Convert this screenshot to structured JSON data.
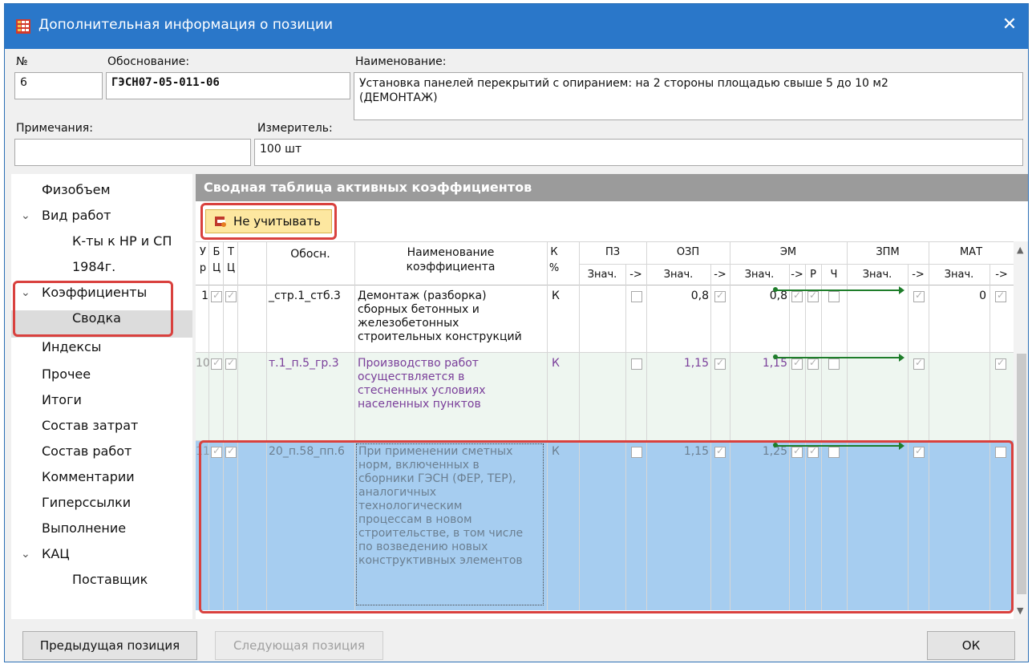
{
  "window": {
    "title": "Дополнительная информация о позиции",
    "close_icon": "close-icon"
  },
  "fields": {
    "num_label": "№",
    "num_value": "6",
    "basis_label": "Обоснование:",
    "basis_value": "ГЭСН07-05-011-06",
    "name_label": "Наименование:",
    "name_value_line1": "Установка панелей перекрытий с опиранием: на 2 стороны площадью свыше 5 до 10 м2",
    "name_value_line2": "(ДЕМОНТАЖ)",
    "notes_label": "Примечания:",
    "notes_value": "",
    "unit_label": "Измеритель:",
    "unit_value": "100 шт"
  },
  "nav": {
    "items": [
      {
        "label": "Физобъем"
      },
      {
        "label": "Вид работ",
        "expandable": true
      },
      {
        "label": "К-ты к НР и СП"
      },
      {
        "label": "1984г."
      },
      {
        "label": "Коэффициенты",
        "expandable": true
      },
      {
        "label": "Сводка",
        "selected": true
      },
      {
        "label": "Индексы"
      },
      {
        "label": "Прочее"
      },
      {
        "label": "Итоги"
      },
      {
        "label": "Состав затрат"
      },
      {
        "label": "Состав работ"
      },
      {
        "label": "Комментарии"
      },
      {
        "label": "Гиперссылки"
      },
      {
        "label": "Выполнение"
      },
      {
        "label": "КАЦ",
        "expandable": true
      },
      {
        "label": "Поставщик"
      }
    ]
  },
  "panel": {
    "header": "Сводная таблица активных коэффициентов",
    "ignore_button": "Не учитывать",
    "columns": {
      "ur1": "У",
      "ur2": "р",
      "bc1": "Б",
      "bc2": "Ц",
      "tc1": "Т",
      "tc2": "Ц",
      "basis": "Обосн.",
      "name1": "Наименование",
      "name2": "коэффициента",
      "kp1": "К",
      "kp2": "%",
      "pz": "ПЗ",
      "ozp": "ОЗП",
      "em": "ЭМ",
      "zpm": "ЗПМ",
      "mat": "МАТ",
      "val": "Знач.",
      "arrow": "->",
      "r": "Р",
      "ch": "Ч"
    },
    "rows": [
      {
        "level": "1",
        "basis": "_стр.1_стб.3",
        "name_lines": [
          "Демонтаж (разборка)",
          "сборных бетонных и",
          "железобетонных",
          "строительных конструкций"
        ],
        "k": "К",
        "ozp": "0,8",
        "em": "0,8",
        "mat": "0"
      },
      {
        "level": "10",
        "basis": "т.1_п.5_гр.3",
        "name_lines": [
          "Производство работ",
          "осуществляется в",
          "стесненных условиях",
          "населенных пунктов"
        ],
        "k": "К",
        "ozp": "1,15",
        "em": "1,15",
        "mat": ""
      },
      {
        "level": "11",
        "basis": "20_п.58_пп.6",
        "name_lines": [
          "При применении сметных",
          "норм, включенных в",
          "сборники ГЭСН (ФЕР, ТЕР),",
          "аналогичных",
          "технологическим",
          "процессам в новом",
          "строительстве, в том числе",
          "по возведению новых",
          "конструктивных элементов"
        ],
        "k": "К",
        "ozp": "1,15",
        "em": "1,25",
        "mat": ""
      }
    ]
  },
  "footer": {
    "prev": "Предыдущая позиция",
    "next": "Следующая позиция",
    "ok": "ОК"
  },
  "colors": {
    "titlebar": "#2a77c9",
    "highlight": "#d9413e",
    "row_selected": "#a6cdf0",
    "button_yellow": "#fde7a0",
    "purple_text": "#7a3f9a",
    "green_arrow": "#1e7d2a"
  }
}
